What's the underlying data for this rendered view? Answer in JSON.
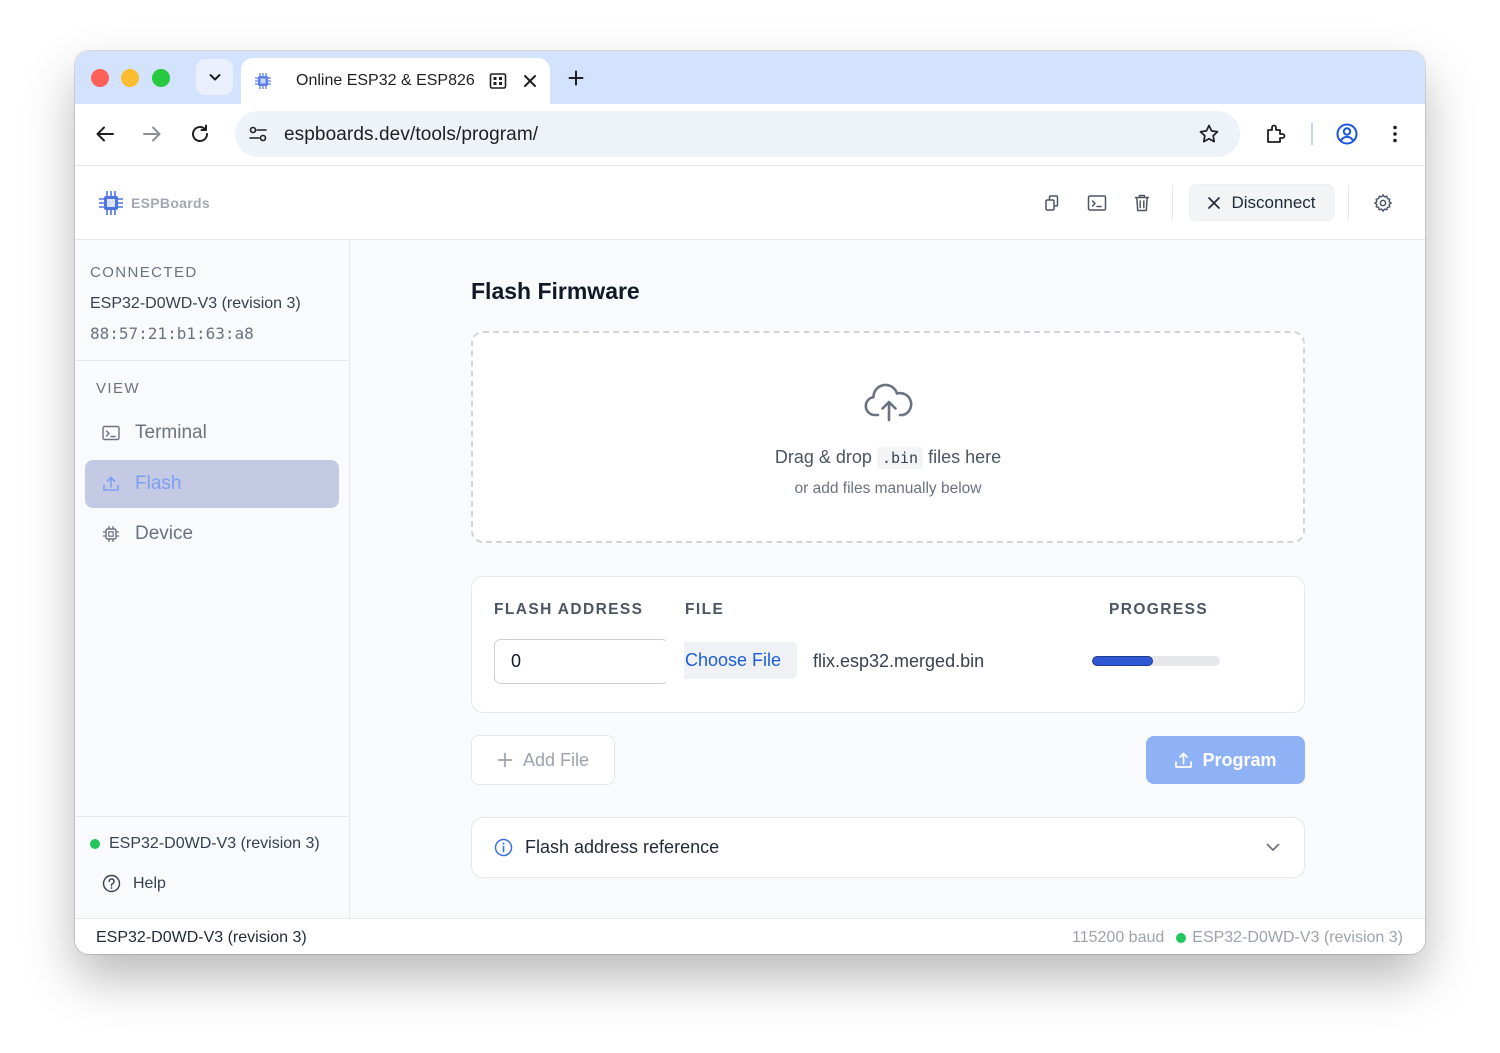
{
  "browser": {
    "tab_title": "Online ESP32 & ESP8266",
    "url": "espboards.dev/tools/program/"
  },
  "header": {
    "logo_text": "ESPBoards",
    "disconnect_label": "Disconnect"
  },
  "sidebar": {
    "connected_label": "CONNECTED",
    "device_name": "ESP32-D0WD-V3 (revision 3)",
    "mac_address": "88:57:21:b1:63:a8",
    "view_label": "VIEW",
    "items": [
      {
        "label": "Terminal",
        "icon": "terminal-icon",
        "active": false
      },
      {
        "label": "Flash",
        "icon": "upload-icon",
        "active": true
      },
      {
        "label": "Device",
        "icon": "chip-icon",
        "active": false
      }
    ],
    "status_device": "ESP32-D0WD-V3 (revision 3)",
    "help_label": "Help"
  },
  "main": {
    "title": "Flash Firmware",
    "dropzone": {
      "text_before": "Drag & drop",
      "code": ".bin",
      "text_after": "files here",
      "subtext": "or add files manually below"
    },
    "table": {
      "col_address": "FLASH ADDRESS",
      "col_file": "FILE",
      "col_progress": "PROGRESS",
      "rows": [
        {
          "address": "0",
          "choose_label": "Choose File",
          "file_name": "flix.esp32.merged.bin",
          "progress": 0.48
        }
      ]
    },
    "add_file_label": "Add File",
    "program_label": "Program",
    "reference_label": "Flash address reference"
  },
  "statusbar": {
    "left_device": "ESP32-D0WD-V3 (revision 3)",
    "baud": "115200 baud",
    "right_device": "ESP32-D0WD-V3 (revision 3)"
  },
  "colors": {
    "accent": "#8fb1f6",
    "link": "#1d5ed8",
    "progress": "#2f57d4",
    "status_green": "#22c55e",
    "tabstrip": "#d3e3fd"
  }
}
